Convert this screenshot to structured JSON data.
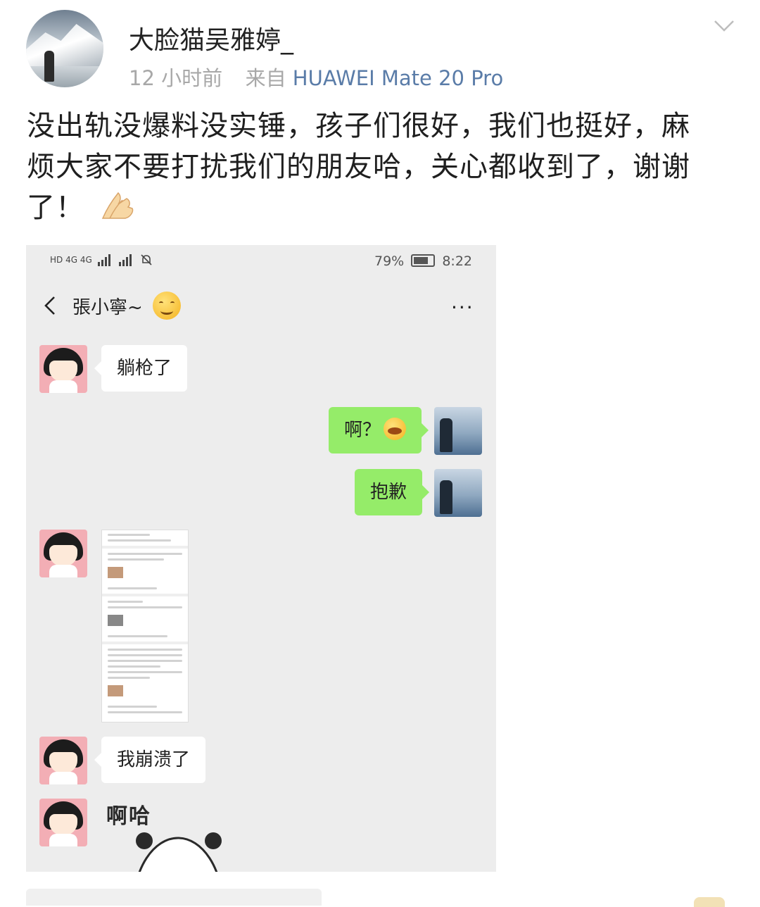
{
  "post": {
    "username": "大脸猫吴雅婷_",
    "time": "12 小时前",
    "from_label": "来自",
    "device": "HUAWEI Mate 20 Pro",
    "text_lines": [
      "没出轨没爆料没实锤，孩子们很好，我们也挺好，麻",
      "烦大家不要打扰我们的朋友哈，关心都收到了，谢谢",
      "了！"
    ]
  },
  "screenshot": {
    "status_bar": {
      "left": "HD 4G 4G",
      "battery": "79%",
      "time": "8:22"
    },
    "chat": {
      "title": "張小寧~",
      "more_label": "···",
      "messages": [
        {
          "side": "left",
          "text": "躺枪了"
        },
        {
          "side": "right",
          "text": "啊？"
        },
        {
          "side": "right",
          "text": "抱歉"
        },
        {
          "side": "left",
          "type": "image"
        },
        {
          "side": "left",
          "text": "我崩溃了"
        },
        {
          "side": "left",
          "type": "sticker",
          "text": "啊哈"
        }
      ]
    }
  },
  "icons": {
    "expand": "chevron-down-icon",
    "back": "chevron-left-icon",
    "more": "more-icon",
    "emoji_post": "folded-hands-icon",
    "emoji_title": "smile-icon",
    "emoji_msg": "crying-laughing-icon"
  },
  "colors": {
    "device_link": "#5a7ca8",
    "bubble_green": "#95ec69",
    "chat_bg": "#ededed"
  }
}
